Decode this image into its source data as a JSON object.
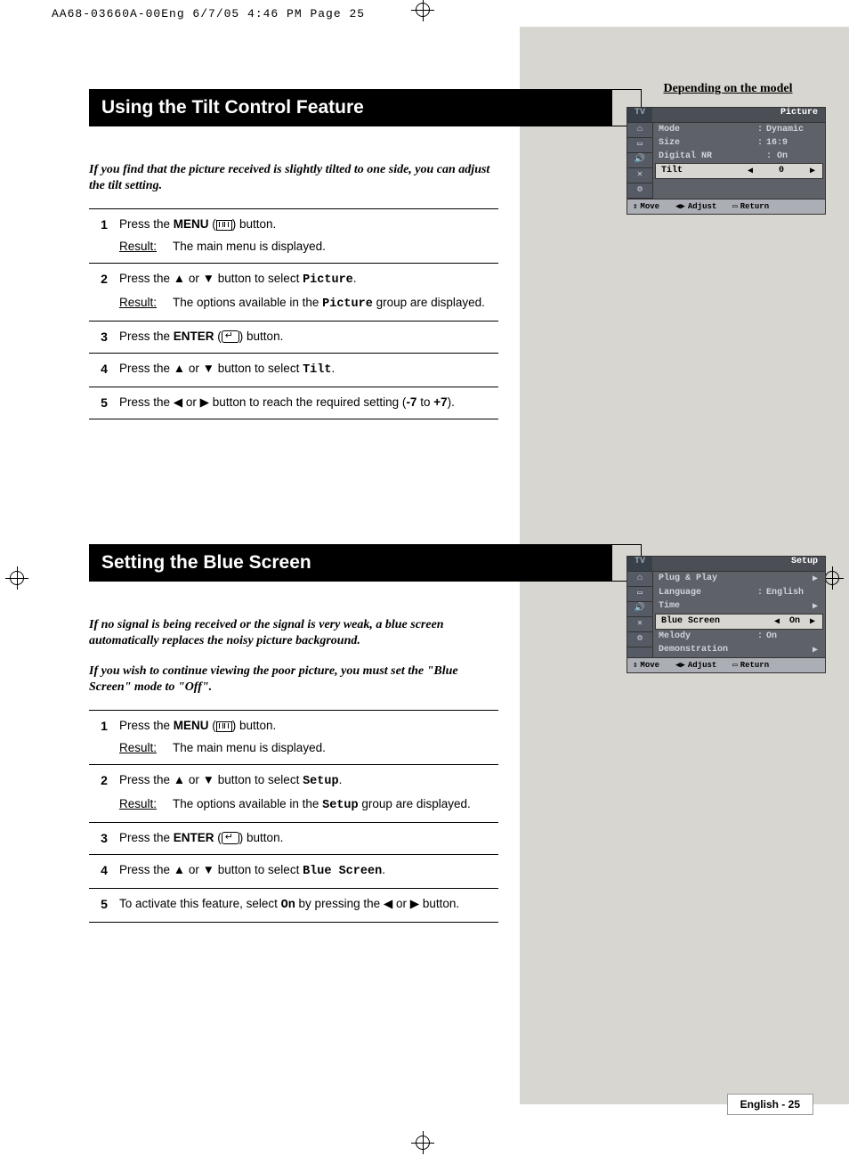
{
  "header_info": "AA68-03660A-00Eng  6/7/05  4:46 PM  Page 25",
  "s1": {
    "title": "Using the Tilt Control Feature",
    "intro": "If you find that the picture received is slightly tilted to one side, you can adjust the tilt setting.",
    "steps": [
      {
        "n": "1",
        "a": "Press the ",
        "b": "MENU",
        "c": " (",
        "d": ") button.",
        "res": "The main menu is displayed."
      },
      {
        "n": "2",
        "a": "Press the ▲ or ▼ button to select ",
        "m": "Picture",
        "c": ".",
        "res": "The options available in the ",
        "resm": "Picture",
        "res2": " group are displayed."
      },
      {
        "n": "3",
        "a": "Press the ",
        "b": "ENTER",
        "c": " (",
        "d": ") button."
      },
      {
        "n": "4",
        "a": "Press the ▲ or ▼ button to select ",
        "m": "Tilt",
        "c": "."
      },
      {
        "n": "5",
        "a": "Press the ◀ or ▶ button to reach the required setting (",
        "b": "-7",
        "c": " to ",
        "b2": "+7",
        "d": ")."
      }
    ]
  },
  "s2": {
    "title": "Setting the Blue Screen",
    "intro1": "If no signal is being received or the signal is very weak, a blue screen automatically replaces the noisy picture background.",
    "intro2": "If you wish to continue viewing the poor picture, you must set the \"Blue Screen\" mode to \"Off\".",
    "steps": [
      {
        "n": "1",
        "a": "Press the ",
        "b": "MENU",
        "c": " (",
        "d": ") button.",
        "res": "The main menu is displayed."
      },
      {
        "n": "2",
        "a": "Press the ▲ or ▼ button to select ",
        "m": "Setup",
        "c": ".",
        "res": "The options available in the ",
        "resm": "Setup",
        "res2": " group are displayed."
      },
      {
        "n": "3",
        "a": "Press the ",
        "b": "ENTER",
        "c": " (",
        "d": ") button."
      },
      {
        "n": "4",
        "a": "Press the ▲ or ▼ button to select ",
        "m": "Blue Screen",
        "c": "."
      },
      {
        "n": "5",
        "a": "To activate this feature, select ",
        "m": "On",
        "c": " by pressing the ◀ or ▶ button."
      }
    ]
  },
  "osd_caption": "Depending on the model",
  "osd1": {
    "tv": "TV",
    "title": "Picture",
    "rows": [
      {
        "k": "Mode",
        "c": ":",
        "v": "Dynamic"
      },
      {
        "k": "Size",
        "c": ":",
        "v": "16:9"
      },
      {
        "k": "Digital NR",
        "c": "",
        "v": ":  On"
      },
      {
        "k": "Tilt",
        "sel": true,
        "l": "◀",
        "v": "0",
        "r": "▶"
      }
    ],
    "ftr": {
      "move": "Move",
      "adj": "Adjust",
      "ret": "Return"
    },
    "icons": [
      "⌂",
      "▭",
      "🔊",
      "✕",
      "⚙"
    ]
  },
  "osd2": {
    "tv": "TV",
    "title": "Setup",
    "rows": [
      {
        "k": "Plug & Play",
        "v": "",
        "r": "▶"
      },
      {
        "k": "Language",
        "c": ":",
        "v": "English"
      },
      {
        "k": "Time",
        "v": "",
        "r": "▶"
      },
      {
        "k": "Blue Screen",
        "sel": true,
        "l": "◀",
        "v": "On",
        "r": "▶"
      },
      {
        "k": "Melody",
        "c": ":",
        "v": "On"
      },
      {
        "k": "Demonstration",
        "v": "",
        "r": "▶"
      }
    ],
    "ftr": {
      "move": "Move",
      "adj": "Adjust",
      "ret": "Return"
    },
    "icons": [
      "⌂",
      "▭",
      "🔊",
      "✕",
      "⚙"
    ]
  },
  "page_num": "English - 25",
  "labels": {
    "result": "Result:"
  }
}
